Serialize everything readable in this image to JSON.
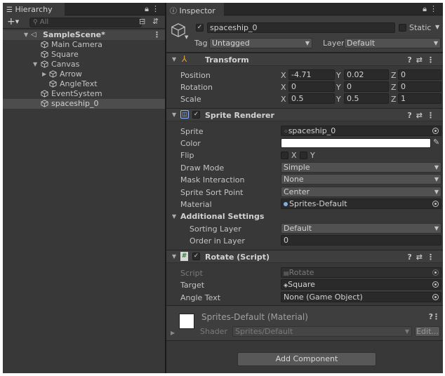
{
  "hierarchy": {
    "tab_label": "Hierarchy",
    "search_placeholder": "All",
    "scene_name": "SampleScene*",
    "items": [
      {
        "label": "Main Camera"
      },
      {
        "label": "Square"
      },
      {
        "label": "Canvas"
      },
      {
        "label": "Arrow"
      },
      {
        "label": "AngleText"
      },
      {
        "label": "EventSystem"
      },
      {
        "label": "spaceship_0"
      }
    ]
  },
  "inspector": {
    "tab_label": "Inspector",
    "object_name": "spaceship_0",
    "static_label": "Static",
    "tag_label": "Tag",
    "tag_value": "Untagged",
    "layer_label": "Layer",
    "layer_value": "Default",
    "transform": {
      "title": "Transform",
      "position_label": "Position",
      "rotation_label": "Rotation",
      "scale_label": "Scale",
      "position": {
        "x": "-4.71",
        "y": "0.02",
        "z": "0"
      },
      "rotation": {
        "x": "0",
        "y": "0",
        "z": "0"
      },
      "scale": {
        "x": "0.5",
        "y": "0.5",
        "z": "1"
      }
    },
    "axis_labels": {
      "x": "X",
      "y": "Y",
      "z": "Z"
    },
    "sprite_renderer": {
      "title": "Sprite Renderer",
      "sprite_label": "Sprite",
      "sprite_value": "spaceship_0",
      "color_label": "Color",
      "color_value": "#FFFFFF",
      "flip_label": "Flip",
      "flip_x": "X",
      "flip_y": "Y",
      "draw_mode_label": "Draw Mode",
      "draw_mode_value": "Simple",
      "mask_label": "Mask Interaction",
      "mask_value": "None",
      "sort_point_label": "Sprite Sort Point",
      "sort_point_value": "Center",
      "material_label": "Material",
      "material_value": "Sprites-Default",
      "additional_settings": "Additional Settings",
      "sorting_layer_label": "Sorting Layer",
      "sorting_layer_value": "Default",
      "order_label": "Order in Layer",
      "order_value": "0"
    },
    "rotate_script": {
      "title": "Rotate (Script)",
      "script_label": "Script",
      "script_value": "Rotate",
      "target_label": "Target",
      "target_value": "Square",
      "angle_text_label": "Angle Text",
      "angle_text_value": "None (Game Object)"
    },
    "material": {
      "title": "Sprites-Default (Material)",
      "shader_label": "Shader",
      "shader_value": "Sprites/Default",
      "edit_label": "Edit..."
    },
    "add_component": "Add Component"
  },
  "colors": {
    "panel_bg": "#383838",
    "field_bg": "#2A2A2A",
    "selected_row": "#4D4D4D",
    "text": "#C4C4C4"
  }
}
